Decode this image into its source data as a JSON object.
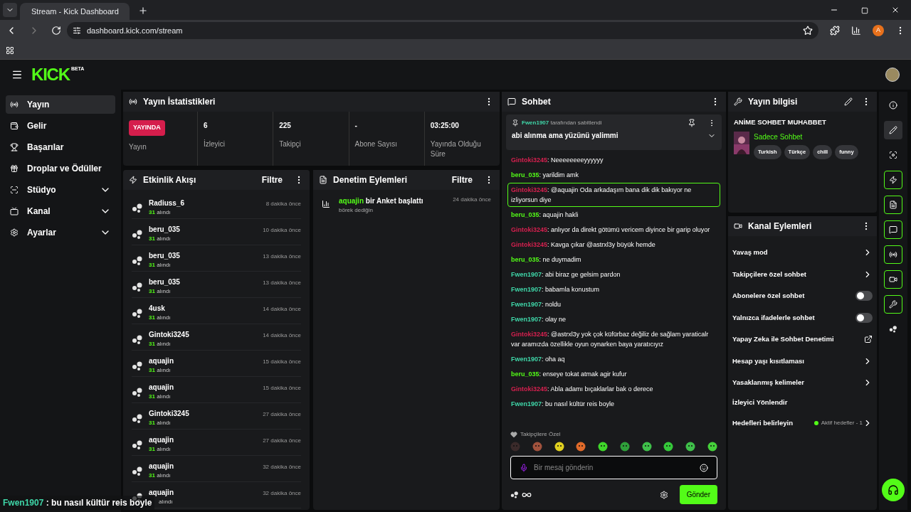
{
  "browser": {
    "tab_title": "Stream - Kick Dashboard",
    "url": "dashboard.kick.com/stream",
    "profile_initial": "A"
  },
  "header": {
    "logo": "KICK",
    "logo_badge": "BETA"
  },
  "sidebar": {
    "items": [
      {
        "label": "Yayın",
        "kind": "radio",
        "selected": true,
        "expandable": false
      },
      {
        "label": "Gelir",
        "kind": "wallet",
        "selected": false,
        "expandable": false
      },
      {
        "label": "Başarılar",
        "kind": "trophy",
        "selected": false,
        "expandable": false
      },
      {
        "label": "Droplar ve Ödüller",
        "kind": "gift",
        "selected": false,
        "expandable": false
      },
      {
        "label": "Stüdyo",
        "kind": "studio",
        "selected": false,
        "expandable": true
      },
      {
        "label": "Kanal",
        "kind": "tv",
        "selected": false,
        "expandable": true
      },
      {
        "label": "Ayarlar",
        "kind": "settings",
        "selected": false,
        "expandable": true
      }
    ]
  },
  "stats": {
    "title": "Yayın İstatistikleri",
    "live_badge": "YAYINDA",
    "live_label": "Yayın",
    "cells": [
      {
        "value": "6",
        "label": "İzleyici"
      },
      {
        "value": "225",
        "label": "Takipçi"
      },
      {
        "value": "-",
        "label": "Abone Sayısı"
      },
      {
        "value": "03:25:00",
        "label": "Yayında Olduğu Süre"
      }
    ]
  },
  "events": {
    "title": "Etkinlik Akışı",
    "filter": "Filtre",
    "items": [
      {
        "user": "Radiuss_6",
        "amount": "31",
        "sub": "alındı",
        "time": "8 dakika önce"
      },
      {
        "user": "beru_035",
        "amount": "31",
        "sub": "alındı",
        "time": "10 dakika önce"
      },
      {
        "user": "beru_035",
        "amount": "31",
        "sub": "alındı",
        "time": "13 dakika önce"
      },
      {
        "user": "beru_035",
        "amount": "31",
        "sub": "alındı",
        "time": "13 dakika önce"
      },
      {
        "user": "4usk",
        "amount": "31",
        "sub": "alındı",
        "time": "14 dakika önce"
      },
      {
        "user": "Gintoki3245",
        "amount": "31",
        "sub": "alındı",
        "time": "14 dakika önce"
      },
      {
        "user": "aquajin",
        "amount": "31",
        "sub": "alındı",
        "time": "15 dakika önce"
      },
      {
        "user": "aquajin",
        "amount": "31",
        "sub": "alındı",
        "time": "15 dakika önce"
      },
      {
        "user": "Gintoki3245",
        "amount": "31",
        "sub": "alındı",
        "time": "27 dakika önce"
      },
      {
        "user": "aquajin",
        "amount": "31",
        "sub": "alındı",
        "time": "27 dakika önce"
      },
      {
        "user": "aquajin",
        "amount": "31",
        "sub": "alındı",
        "time": "32 dakika önce"
      },
      {
        "user": "aquajin",
        "sub": "alındı",
        "time": "32 dakika önce"
      }
    ]
  },
  "moderation": {
    "title": "Denetim Eylemleri",
    "filter": "Filtre",
    "items": [
      {
        "user": "aquajin",
        "action": "bir Anket başlattı",
        "detail": "börek dediğin",
        "time": "24 dakika önce"
      }
    ]
  },
  "chat": {
    "title": "Sohbet",
    "separator": ": ",
    "pinned": {
      "user": "Fwen1907",
      "by": "tarafından sabitlendi",
      "text": "abi alınma ama yüzünü yalimmi"
    },
    "messages": [
      {
        "user": "Gintoki3245",
        "color": "#d6204f",
        "text": "Neeeeeeeeyyyyyy",
        "highlighted": false
      },
      {
        "user": "beru_035",
        "color": "#53fc18",
        "text": "yarildim amk",
        "highlighted": false
      },
      {
        "user": "Gintoki3245",
        "color": "#d6204f",
        "text": "@aquajin Oda arkadaşım bana dik dik bakıyor ne izliyorsun diye",
        "highlighted": true
      },
      {
        "user": "beru_035",
        "color": "#53fc18",
        "text": "aquajin hakli",
        "highlighted": false
      },
      {
        "user": "Gintoki3245",
        "color": "#d6204f",
        "text": "anlıyor da direkt götümü vericem diyince bir garip oluyor",
        "highlighted": false
      },
      {
        "user": "Gintoki3245",
        "color": "#d6204f",
        "text": "Kavga çıkar @astrxl3y büyük hemde",
        "highlighted": false
      },
      {
        "user": "beru_035",
        "color": "#53fc18",
        "text": "ne duymadim",
        "highlighted": false
      },
      {
        "user": "Fwen1907",
        "color": "#3fd6a8",
        "text": "abi biraz ge gelsim pardon",
        "highlighted": false
      },
      {
        "user": "Fwen1907",
        "color": "#3fd6a8",
        "text": "babamla konustum",
        "highlighted": false
      },
      {
        "user": "Fwen1907",
        "color": "#3fd6a8",
        "text": "noldu",
        "highlighted": false
      },
      {
        "user": "Fwen1907",
        "color": "#3fd6a8",
        "text": "olay ne",
        "highlighted": false
      },
      {
        "user": "Gintoki3245",
        "color": "#d6204f",
        "text": "@astrxl3y yok çok küfürbaz değiliz de sağlam yaraticalr var aramızda özellikle oyun oynarken baya yaratıcıyız",
        "highlighted": false
      },
      {
        "user": "Fwen1907",
        "color": "#3fd6a8",
        "text": "oha aq",
        "highlighted": false
      },
      {
        "user": "beru_035",
        "color": "#53fc18",
        "text": "enseye tokat atmak agir kufur",
        "highlighted": false
      },
      {
        "user": "Gintoki3245",
        "color": "#d6204f",
        "text": "Abla adamı bıçaklarlar bak o derece",
        "highlighted": false
      },
      {
        "user": "Fwen1907",
        "color": "#3fd6a8",
        "text": "bu nasıl kültür reis boyle",
        "highlighted": false
      }
    ],
    "emote_section": "Takipçilere Özel",
    "emotes": [
      {
        "color": "#3a2a2a"
      },
      {
        "color": "#a0523d"
      },
      {
        "color": "#e0d020"
      },
      {
        "color": "#e06a2a"
      },
      {
        "color": "#3fd62a"
      },
      {
        "color": "#2f9f3a"
      },
      {
        "color": "#3fbf4a"
      },
      {
        "color": "#35c83a"
      },
      {
        "color": "#3fbf4a"
      },
      {
        "color": "#45d03a"
      }
    ],
    "input_placeholder": "Bir mesaj gönderin",
    "send": "Gönder"
  },
  "stream_info": {
    "title": "Yayın bilgisi",
    "stream_title": "ANİME SOHBET MUHABBET",
    "category": "Sadece Sohbet",
    "tags": [
      "Turkish",
      "Türkçe",
      "chill",
      "funny"
    ]
  },
  "channel_actions": {
    "title": "Kanal Eylemleri",
    "items": [
      {
        "label": "Yavaş mod",
        "kind": "arrow"
      },
      {
        "label": "Takipçilere özel sohbet",
        "kind": "arrow"
      },
      {
        "label": "Abonelere özel sohbet",
        "kind": "toggle",
        "on": false
      },
      {
        "label": "Yalnızca ifadelerle sohbet",
        "kind": "toggle",
        "on": false
      },
      {
        "label": "Yapay Zeka ile Sohbet Denetimi",
        "kind": "external"
      },
      {
        "label": "Hesap yaşı kısıtlaması",
        "kind": "arrow"
      },
      {
        "label": "Yasaklanmış kelimeler",
        "kind": "arrow"
      },
      {
        "label": "İzleyici Yönlendir",
        "kind": "plain"
      },
      {
        "label": "Hedefleri belirleyin",
        "kind": "goal",
        "status": "Aktif hedefler - 1"
      }
    ]
  },
  "rail": [
    {
      "kind": "info",
      "selected": false,
      "outlined": false
    },
    {
      "kind": "edit",
      "selected": true,
      "outlined": false
    },
    {
      "kind": "screen",
      "selected": false,
      "outlined": false
    },
    {
      "kind": "bolt",
      "selected": false,
      "outlined": true
    },
    {
      "kind": "doc",
      "selected": false,
      "outlined": true
    },
    {
      "kind": "chat",
      "selected": false,
      "outlined": true
    },
    {
      "kind": "radio",
      "selected": false,
      "outlined": true
    },
    {
      "kind": "video",
      "selected": false,
      "outlined": true
    },
    {
      "kind": "wrench",
      "selected": false,
      "outlined": true
    },
    {
      "kind": "dots",
      "selected": false,
      "outlined": false
    }
  ],
  "overlay": {
    "user": "Fwen1907",
    "text": ": bu nasıl kültür reis boyle"
  }
}
